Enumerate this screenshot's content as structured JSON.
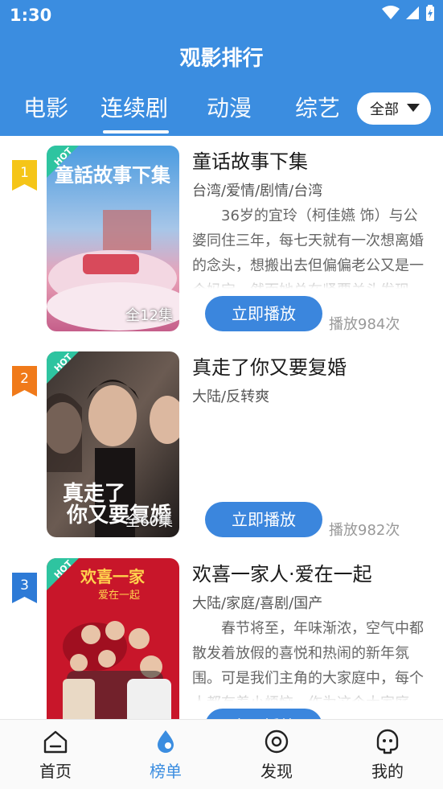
{
  "status_bar": {
    "time": "1:30"
  },
  "header": {
    "title": "观影排行"
  },
  "tabs": [
    {
      "label": "电影"
    },
    {
      "label": "连续剧"
    },
    {
      "label": "动漫"
    },
    {
      "label": "综艺"
    }
  ],
  "active_tab": "连续剧",
  "filter": {
    "label": "全部"
  },
  "items": [
    {
      "rank": "1",
      "rank_color": "#f5c518",
      "badge": "HOT",
      "episodes": "全12集",
      "title": "童话故事下集",
      "tags": "台湾/爱情/剧情/台湾",
      "description": "36岁的宜玲（柯佳嬿 饰）与公婆同住三年，每七天就有一次想离婚的念头，想搬出去但偏偏老公又是一个妈宝。然而她总在紧要关头发现…",
      "play_label": "立即播放",
      "plays": "播放984次"
    },
    {
      "rank": "2",
      "rank_color": "#f07a1a",
      "badge": "HOT",
      "episodes": "全60集",
      "title": "真走了你又要复婚",
      "tags": "大陆/反转爽",
      "description": "",
      "play_label": "立即播放",
      "plays": "播放982次"
    },
    {
      "rank": "3",
      "rank_color": "#2d7ad6",
      "badge": "HOT",
      "episodes": "",
      "title": "欢喜一家人·爱在一起",
      "tags": "大陆/家庭/喜剧/国产",
      "description": "春节将至，年味渐浓，空气中都散发着放假的喜悦和热闹的新年氛围。可是我们主角的大家庭中，每个人都有着小烦恼。作为这个大家庭…",
      "play_label": "立即播放",
      "plays": ""
    }
  ],
  "bottom_nav": [
    {
      "label": "首页",
      "icon": "home-icon"
    },
    {
      "label": "榜单",
      "icon": "rank-drop-icon"
    },
    {
      "label": "发现",
      "icon": "discover-icon"
    },
    {
      "label": "我的",
      "icon": "profile-icon"
    }
  ],
  "colors": {
    "primary": "#3b8de0",
    "hot_badge": "#2ec4a0"
  }
}
